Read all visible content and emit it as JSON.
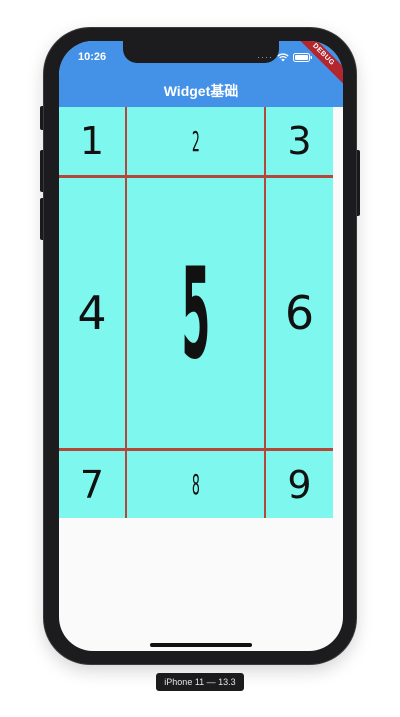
{
  "status_bar": {
    "time": "10:26",
    "signal": "····"
  },
  "debug_banner": "DEBUG",
  "app_bar": {
    "title": "Widget基础",
    "background": "#4491e8"
  },
  "grid": {
    "background": "#7ef8ee",
    "divider_color": "#b5473a",
    "cells": [
      "1",
      "2",
      "3",
      "4",
      "5",
      "6",
      "7",
      "8",
      "9"
    ]
  },
  "device_label": "iPhone 11 — 13.3",
  "icons": {
    "wifi": "wifi-icon",
    "battery": "battery-icon"
  }
}
